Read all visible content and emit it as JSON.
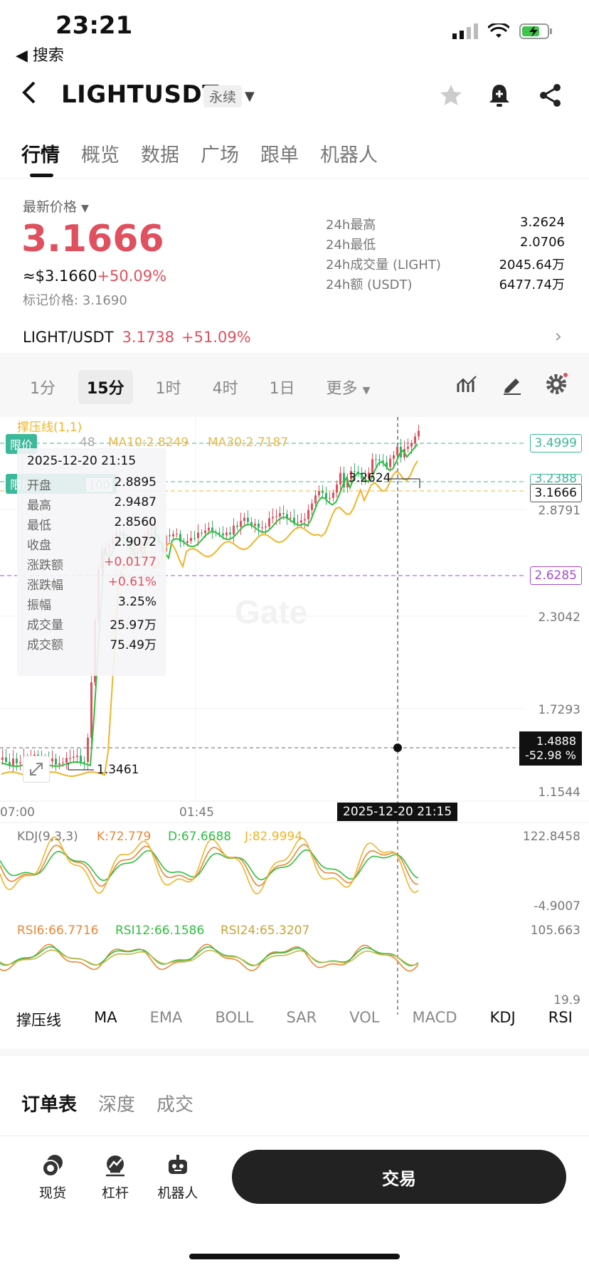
{
  "status": {
    "time": "23:21",
    "back_app": "◀ 搜索"
  },
  "header": {
    "pair": "LIGHTUSDT",
    "contract_type": "永续"
  },
  "tabs": [
    "行情",
    "概览",
    "数据",
    "广场",
    "跟单",
    "机器人"
  ],
  "price": {
    "label": "最新价格",
    "last": "3.1666",
    "usd": "≈$3.1660",
    "change": "+50.09%",
    "mark": "标记价格: 3.1690"
  },
  "stats": [
    {
      "k": "24h最高",
      "v": "3.2624"
    },
    {
      "k": "24h最低",
      "v": "2.0706"
    },
    {
      "k": "24h成交量 (LIGHT)",
      "v": "2045.64万"
    },
    {
      "k": "24h额 (USDT)",
      "v": "6477.74万"
    }
  ],
  "spot": {
    "pair": "LIGHT/USDT",
    "price": "3.1738",
    "change": "+51.09%"
  },
  "intervals": [
    "1分",
    "15分",
    "1时",
    "4时",
    "1日",
    "更多"
  ],
  "chart": {
    "sr_label": "撑压线(1,1)",
    "limit_label": "限价",
    "ma_fragment": "48",
    "ma10": "MA10:2.8249",
    "ma30": "MA30:2.7187",
    "limit_box2": "100",
    "y_axis": [
      "2.8791",
      "2.3042",
      "1.7293",
      "1.1544"
    ],
    "tags": {
      "line1": "3.4999",
      "line2": "3.2388",
      "current": "3.1666",
      "purple": "2.6285"
    },
    "high_label": "3.2624",
    "low_label": "1.3461",
    "crosshair": {
      "price": "1.4888",
      "pct": "-52.98 %",
      "time": "2025-12-20 21:15"
    },
    "x_axis": [
      "07:00",
      "01:45"
    ],
    "watermark": "Gate",
    "colors": {
      "up": "#e0505e",
      "down": "#32b06a",
      "ma_fast": "#2fbf40",
      "ma_slow": "#f0b429",
      "purple": "#a34cd6"
    }
  },
  "tooltip": {
    "date": "2025-12-20 21:15",
    "rows": [
      {
        "k": "开盘",
        "v": "2.8895"
      },
      {
        "k": "最高",
        "v": "2.9487"
      },
      {
        "k": "最低",
        "v": "2.8560"
      },
      {
        "k": "收盘",
        "v": "2.9072"
      },
      {
        "k": "涨跌额",
        "v": "+0.0177"
      },
      {
        "k": "涨跌幅",
        "v": "+0.61%"
      },
      {
        "k": "振幅",
        "v": "3.25%"
      },
      {
        "k": "成交量",
        "v": "25.97万"
      },
      {
        "k": "成交额",
        "v": "75.49万"
      }
    ]
  },
  "kdj": {
    "name": "KDJ(9,3,3)",
    "k": "K:72.779",
    "d": "D:67.6688",
    "j": "J:82.9994",
    "top": "122.8458",
    "bottom": "-4.9007"
  },
  "rsi": {
    "r6": "RSI6:66.7716",
    "r12": "RSI12:66.1586",
    "r24": "RSI24:65.3207",
    "top": "105.663",
    "bottom": "19.9"
  },
  "indicator_tabs": [
    "撑压线",
    "MA",
    "EMA",
    "BOLL",
    "SAR",
    "VOL",
    "MACD",
    "KDJ",
    "RSI"
  ],
  "book_tabs": [
    "订单表",
    "深度",
    "成交"
  ],
  "bottom_nav": [
    "现货",
    "杠杆",
    "机器人"
  ],
  "trade_button": "交易"
}
